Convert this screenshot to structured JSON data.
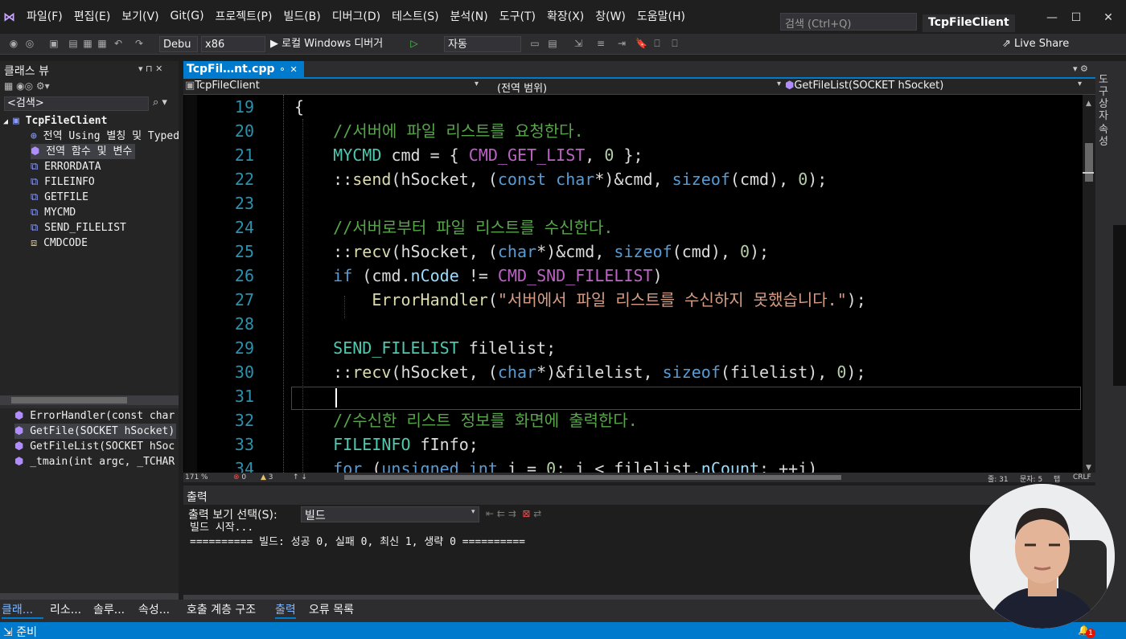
{
  "menu": [
    "파일(F)",
    "편집(E)",
    "보기(V)",
    "Git(G)",
    "프로젝트(P)",
    "빌드(B)",
    "디버그(D)",
    "테스트(S)",
    "분석(N)",
    "도구(T)",
    "확장(X)",
    "창(W)",
    "도움말(H)"
  ],
  "search_placeholder": "검색 (Ctrl+Q)",
  "app_title": "TcpFileClient",
  "toolbar": {
    "config": "Debu",
    "platform": "x86",
    "run_label": "▶ 로컬 Windows 디버거",
    "auto": "자동",
    "live_share": "Live Share"
  },
  "classview": {
    "title": "클래스 뷰",
    "search": "<검색>",
    "root": "TcpFileClient",
    "items": [
      "전역 Using 별칭 및 Typed",
      "전역 함수 및 변수",
      "ERRORDATA",
      "FILEINFO",
      "GETFILE",
      "MYCMD",
      "SEND_FILELIST",
      "CMDCODE"
    ],
    "members": [
      "ErrorHandler(const char",
      "GetFile(SOCKET hSocket)",
      "GetFileList(SOCKET hSoc",
      "_tmain(int argc, _TCHAR"
    ]
  },
  "editor": {
    "tab": "TcpFil…nt.cpp",
    "nav_project": "TcpFileClient",
    "nav_scope": "(전역 범위)",
    "nav_function": "GetFileList(SOCKET hSocket)",
    "line_numbers": [
      "19",
      "20",
      "21",
      "22",
      "23",
      "24",
      "25",
      "26",
      "27",
      "28",
      "29",
      "30",
      "31",
      "32",
      "33",
      "34"
    ],
    "lines": [
      "{",
      "    //서버에 파일 리스트를 요청한다.",
      "    MYCMD cmd = { CMD_GET_LIST, 0 };",
      "    ::send(hSocket, (const char*)&cmd, sizeof(cmd), 0);",
      "",
      "    //서버로부터 파일 리스트를 수신한다.",
      "    ::recv(hSocket, (char*)&cmd, sizeof(cmd), 0);",
      "    if (cmd.nCode != CMD_SND_FILELIST)",
      "        ErrorHandler(\"서버에서 파일 리스트를 수신하지 못했습니다.\");",
      "",
      "    SEND_FILELIST filelist;",
      "    ::recv(hSocket, (char*)&filelist, sizeof(filelist), 0);",
      "",
      "    //수신한 리스트 정보를 화면에 출력한다.",
      "    FILEINFO fInfo;",
      "    for (unsigned int i = 0; i < filelist.nCount; ++i)"
    ],
    "zoom": "171 %",
    "errors": "0",
    "warnings": "3",
    "line_pos": "줄: 31",
    "col_pos": "문자: 5",
    "tab_mode": "탭",
    "eol": "CRLF"
  },
  "output": {
    "title": "출력",
    "source_label": "출력 보기 선택(S):",
    "source_value": "빌드",
    "text": "빌드 시작...\n========== 빌드: 성공 0, 실패 0, 최신 1, 생략 0 =========="
  },
  "left_tabs": [
    "클래...",
    "리소...",
    "솔루...",
    "속성..."
  ],
  "bottom_tabs": [
    "호출 계층 구조",
    "출력",
    "오류 목록"
  ],
  "status": "준비",
  "notifications": "1",
  "right_strip": [
    "도구 상자",
    "속성"
  ]
}
